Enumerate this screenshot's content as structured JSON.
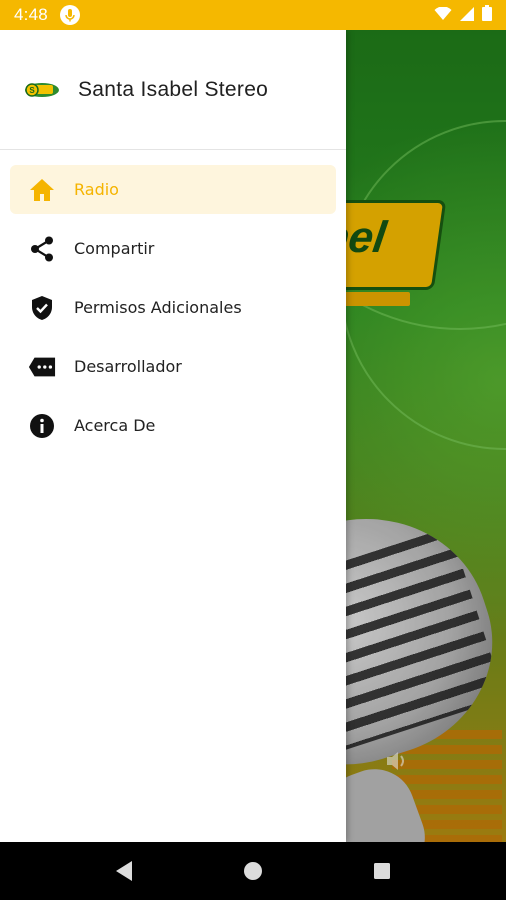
{
  "status_bar": {
    "time": "4:48",
    "notification_icon": "mic-notification-icon",
    "icons": [
      "wifi-icon",
      "signal-icon",
      "battery-icon"
    ]
  },
  "drawer": {
    "header": {
      "logo": "santa-isabel-logo",
      "title": "Santa Isabel Stereo"
    },
    "items": [
      {
        "label": "Radio",
        "icon": "home-icon",
        "active": true
      },
      {
        "label": "Compartir",
        "icon": "share-icon",
        "active": false
      },
      {
        "label": "Permisos Adicionales",
        "icon": "shield-check-icon",
        "active": false
      },
      {
        "label": "Desarrollador",
        "icon": "tag-icon",
        "active": false
      },
      {
        "label": "Acerca De",
        "icon": "info-icon",
        "active": false
      }
    ]
  },
  "background": {
    "logo_text": "bel"
  },
  "colors": {
    "accent": "#F5B800",
    "active_bg": "#FEF5DD",
    "active_text": "#F5B400"
  },
  "nav_bar": {
    "buttons": [
      "back-icon",
      "home-circle-icon",
      "recents-icon"
    ]
  }
}
